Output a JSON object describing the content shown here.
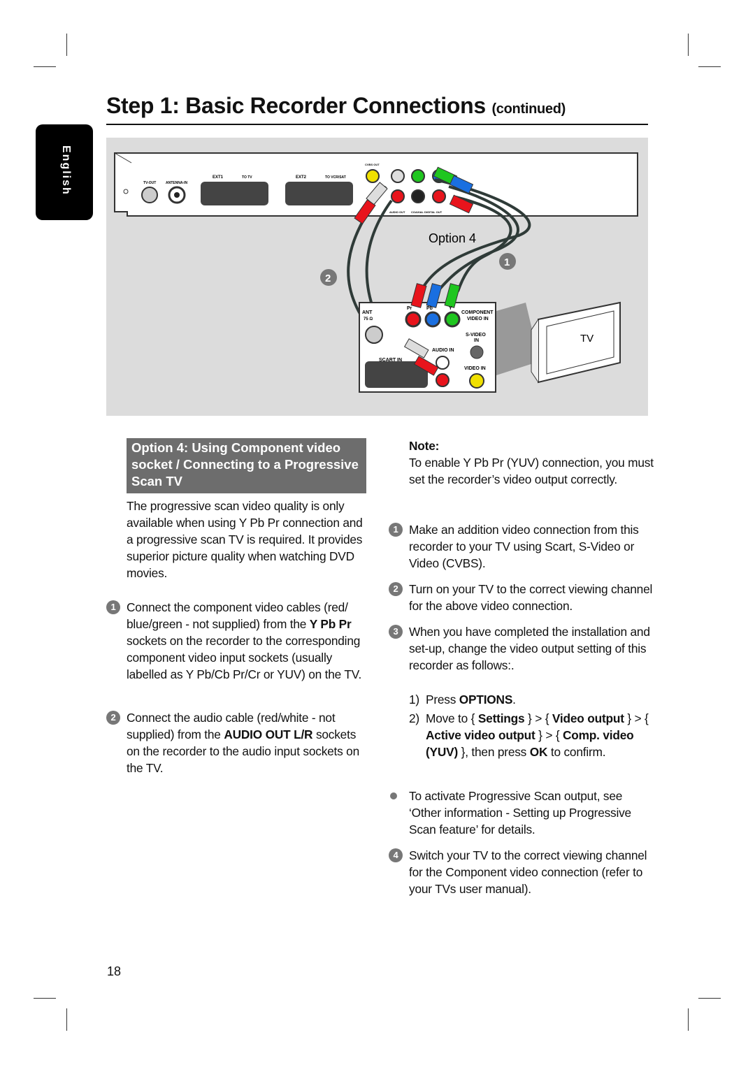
{
  "page": {
    "title": "Step 1: Basic Recorder Connections",
    "title_suffix": "(continued)",
    "side_tab": "English",
    "page_number": "18"
  },
  "diagram": {
    "recorder_labels": {
      "tv_out": "TV-OUT",
      "antenna_in": "ANTENNA-IN",
      "ext1": "EXT1",
      "to_tv": "TO TV",
      "ext2": "EXT2",
      "to_vcr": "TO VCR/SAT",
      "cvbs_out": "CVBS OUT",
      "audio_out": "AUDIO OUT",
      "coaxial": "COAXIAL DIGITAL OUT"
    },
    "option_label": "Option 4",
    "callout_1": "1",
    "callout_2": "2",
    "tv_label": "TV",
    "tv_panel_labels": {
      "ant": "ANT",
      "ohm": "75 Ω",
      "component": "COMPONENT",
      "video_in_c": "VIDEO IN",
      "svideo": "S-VIDEO",
      "svideo_in": "IN",
      "audio_in": "AUDIO IN",
      "scart_in": "SCART IN",
      "video_in": "VIDEO IN",
      "pr": "Pr",
      "pb": "Pb",
      "y": "Y"
    },
    "colors": {
      "red": "#e8141c",
      "blue": "#1a6fe0",
      "green": "#1fc61f",
      "yellow": "#f0e000",
      "panel_bg": "#dcdcdc"
    }
  },
  "left": {
    "header": "Option 4: Using Component video socket / Connecting to a Progressive Scan TV",
    "intro": "The progressive scan video quality is only available when using Y Pb Pr connection and a progressive scan TV is required. It provides superior picture quality when watching DVD movies.",
    "steps": [
      {
        "num": "1",
        "a": "Connect the component video cables (red/ blue/green - not supplied) from the ",
        "bold": "Y Pb Pr",
        "b": " sockets on the recorder to the corresponding component video input sockets (usually labelled as Y Pb/Cb Pr/Cr or YUV) on the TV."
      },
      {
        "num": "2",
        "a": "Connect the audio cable (red/white - not supplied) from the ",
        "bold": "AUDIO OUT L/R",
        "b": " sockets on the recorder to the audio input sockets on the TV."
      }
    ]
  },
  "right": {
    "note_title": "Note:",
    "note_text": "To enable Y Pb Pr (YUV) connection, you must set the recorder’s video output correctly.",
    "items": [
      {
        "num": "1",
        "text": "Make an addition video connection from this recorder to your TV using Scart, S-Video or Video (CVBS)."
      },
      {
        "num": "2",
        "text": "Turn on your TV to the correct viewing channel for the above video connection."
      },
      {
        "num": "3",
        "text": "When you have completed the installation and set-up, change the video output setting of this recorder as follows:."
      }
    ],
    "sub1": {
      "n": "1)",
      "a": "Press ",
      "bold": "OPTIONS",
      "b": "."
    },
    "sub2": {
      "n": "2)",
      "a": "Move to { ",
      "b1": "Settings",
      "c": " } > { ",
      "b2": "Video output",
      "d": " } > { ",
      "b3": "Active video output",
      "e": " } > { ",
      "b4": "Comp. video (YUV)",
      "f": " }, then press ",
      "b5": "OK",
      "g": " to confirm."
    },
    "bullet": "To activate Progressive Scan output, see ‘Other information - Setting up Progressive Scan feature’ for details.",
    "item4": {
      "num": "4",
      "text": "Switch your TV to the correct viewing channel for the Component video connection (refer to your TVs user manual)."
    }
  }
}
